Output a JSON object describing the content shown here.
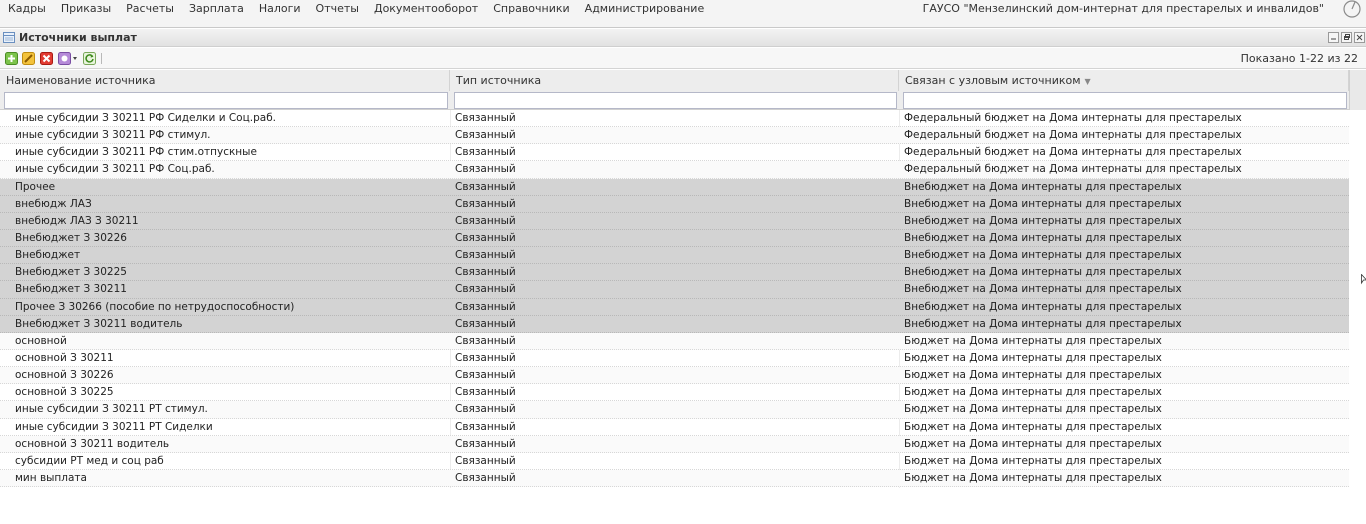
{
  "menu": {
    "items": [
      "Кадры",
      "Приказы",
      "Расчеты",
      "Зарплата",
      "Налоги",
      "Отчеты",
      "Документооборот",
      "Справочники",
      "Администрирование"
    ],
    "org_name": "ГАУСО \"Мензелинский дом-интернат для престарелых и инвалидов\""
  },
  "panel": {
    "title": "Источники выплат"
  },
  "toolbar": {
    "icons": [
      "add-icon",
      "edit-icon",
      "delete-icon",
      "menu-icon",
      "refresh-icon"
    ],
    "status": "Показано 1-22 из 22"
  },
  "grid": {
    "columns": [
      "Наименование источника",
      "Тип источника",
      "Связан с узловым источником"
    ],
    "sorted_column": 2,
    "rows": [
      {
        "name": "иные субсидии З 30211 РФ Сиделки и Соц.раб.",
        "type": "Связанный",
        "linked": "Федеральный бюджет на Дома интернаты для престарелых",
        "selected": false
      },
      {
        "name": "иные субсидии З 30211 РФ стимул.",
        "type": "Связанный",
        "linked": "Федеральный бюджет на Дома интернаты для престарелых",
        "selected": false
      },
      {
        "name": "иные субсидии З 30211 РФ стим.отпускные",
        "type": "Связанный",
        "linked": "Федеральный бюджет на Дома интернаты для престарелых",
        "selected": false
      },
      {
        "name": "иные субсидии З 30211 РФ Соц.раб.",
        "type": "Связанный",
        "linked": "Федеральный бюджет на Дома интернаты для престарелых",
        "selected": false
      },
      {
        "name": "Прочее",
        "type": "Связанный",
        "linked": "Внебюджет на Дома интернаты для престарелых",
        "selected": true
      },
      {
        "name": "внебюдж ЛАЗ",
        "type": "Связанный",
        "linked": "Внебюджет на Дома интернаты для престарелых",
        "selected": true
      },
      {
        "name": "внебюдж ЛАЗ З 30211",
        "type": "Связанный",
        "linked": "Внебюджет на Дома интернаты для престарелых",
        "selected": true
      },
      {
        "name": "Внебюджет З 30226",
        "type": "Связанный",
        "linked": "Внебюджет на Дома интернаты для престарелых",
        "selected": true
      },
      {
        "name": "Внебюджет",
        "type": "Связанный",
        "linked": "Внебюджет на Дома интернаты для престарелых",
        "selected": true
      },
      {
        "name": "Внебюджет З 30225",
        "type": "Связанный",
        "linked": "Внебюджет на Дома интернаты для престарелых",
        "selected": true
      },
      {
        "name": "Внебюджет З 30211",
        "type": "Связанный",
        "linked": "Внебюджет на Дома интернаты для престарелых",
        "selected": true
      },
      {
        "name": "Прочее З 30266 (пособие по нетрудоспособности)",
        "type": "Связанный",
        "linked": "Внебюджет на Дома интернаты для престарелых",
        "selected": true
      },
      {
        "name": "Внебюджет З 30211 водитель",
        "type": "Связанный",
        "linked": "Внебюджет на Дома интернаты для престарелых",
        "selected": true
      },
      {
        "name": "основной",
        "type": "Связанный",
        "linked": "Бюджет на Дома интернаты для престарелых",
        "selected": false
      },
      {
        "name": "основной З 30211",
        "type": "Связанный",
        "linked": "Бюджет на Дома интернаты для престарелых",
        "selected": false
      },
      {
        "name": "основной З 30226",
        "type": "Связанный",
        "linked": "Бюджет на Дома интернаты для престарелых",
        "selected": false
      },
      {
        "name": "основной З 30225",
        "type": "Связанный",
        "linked": "Бюджет на Дома интернаты для престарелых",
        "selected": false
      },
      {
        "name": "иные субсидии З 30211 РТ стимул.",
        "type": "Связанный",
        "linked": "Бюджет на Дома интернаты для престарелых",
        "selected": false
      },
      {
        "name": "иные субсидии З 30211 РТ Сиделки",
        "type": "Связанный",
        "linked": "Бюджет на Дома интернаты для престарелых",
        "selected": false
      },
      {
        "name": "основной З 30211 водитель",
        "type": "Связанный",
        "linked": "Бюджет на Дома интернаты для престарелых",
        "selected": false
      },
      {
        "name": "субсидии РТ мед и соц раб",
        "type": "Связанный",
        "linked": "Бюджет на Дома интернаты для престарелых",
        "selected": false
      },
      {
        "name": "мин выплата",
        "type": "Связанный",
        "linked": "Бюджет на Дома интернаты для престарелых",
        "selected": false
      }
    ]
  }
}
